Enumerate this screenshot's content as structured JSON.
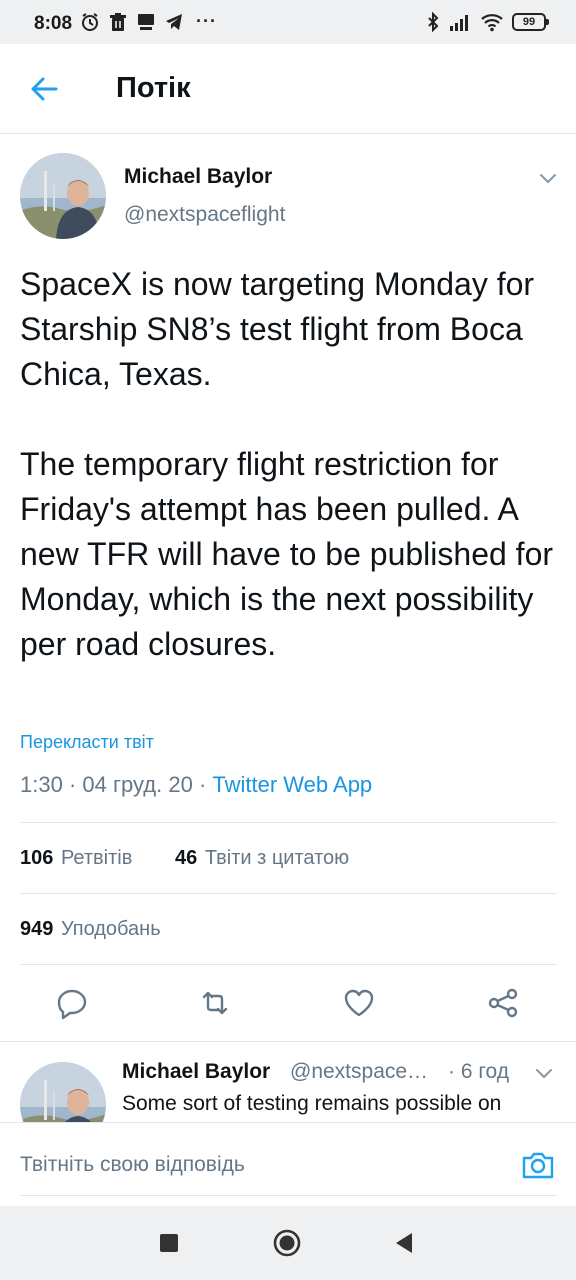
{
  "status_bar": {
    "time": "8:08",
    "dots": "···",
    "battery": "99"
  },
  "header": {
    "title": "Потік"
  },
  "tweet": {
    "author_name": "Michael Baylor",
    "author_handle": "@nextspaceflight",
    "text": "SpaceX is now targeting Monday for Starship SN8’s test flight from Boca Chica, Texas.\n\nThe temporary flight restriction for Friday's attempt has been pulled. A new TFR will have to be published for Monday, which is the next possibility per road closures.",
    "translate_label": "Перекласти твіт",
    "time": "1:30",
    "date": "04 груд. 20",
    "separator": "·",
    "app": "Twitter Web App"
  },
  "stats": {
    "retweets_count": "106",
    "retweets_label": "Ретвітів",
    "quotes_count": "46",
    "quotes_label": "Твіти з цитатою",
    "likes_count": "949",
    "likes_label": "Уподобань"
  },
  "reply": {
    "author_name": "Michael Baylor",
    "author_handle": "@nextspace…",
    "time": "· 6 год",
    "text": "Some sort of testing remains possible on"
  },
  "reply_bar": {
    "placeholder": "Твітніть свою відповідь"
  },
  "colors": {
    "accent": "#1da1f2",
    "link": "#1b95e0",
    "secondary_text": "#657786",
    "divider": "#e1e8ed",
    "system_bar": "#eef0f1"
  },
  "icons": [
    "alarm-icon",
    "trash-icon",
    "chat-icon",
    "telegram-icon",
    "bluetooth-icon",
    "signal-icon",
    "wifi-icon",
    "battery-icon",
    "back-arrow-icon",
    "chevron-down-icon",
    "reply-icon",
    "retweet-icon",
    "like-icon",
    "share-icon",
    "camera-icon",
    "square-nav-icon",
    "home-nav-icon",
    "back-nav-icon"
  ]
}
